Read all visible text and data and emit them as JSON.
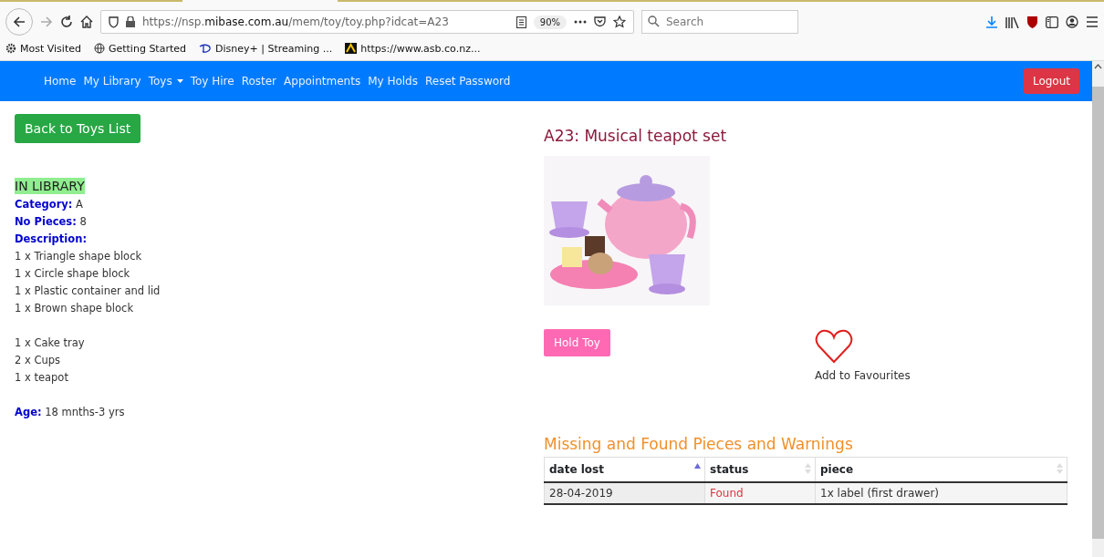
{
  "browser": {
    "url_host": "https://nsp.",
    "url_domain": "mibase.com.au",
    "url_path": "/mem/toy/toy.php?idcat=A23",
    "zoom": "90%",
    "search_placeholder": "Search",
    "bookmarks": [
      {
        "label": "Most Visited"
      },
      {
        "label": "Getting Started"
      },
      {
        "label": "Disney+ | Streaming ..."
      },
      {
        "label": "https://www.asb.co.nz..."
      }
    ]
  },
  "nav": {
    "items": [
      {
        "label": "Home",
        "dropdown": false
      },
      {
        "label": "My Library",
        "dropdown": false
      },
      {
        "label": "Toys",
        "dropdown": true
      },
      {
        "label": "Toy Hire",
        "dropdown": false
      },
      {
        "label": "Roster",
        "dropdown": false
      },
      {
        "label": "Appointments",
        "dropdown": false
      },
      {
        "label": "My Holds",
        "dropdown": false
      },
      {
        "label": "Reset Password",
        "dropdown": false
      }
    ],
    "logout": "Logout"
  },
  "back_button": "Back to Toys List",
  "status_badge": "IN LIBRARY",
  "details": [
    {
      "label": "Category:",
      "value": "A"
    },
    {
      "label": "No Pieces:",
      "value": "8"
    },
    {
      "label": "Description:"
    }
  ],
  "description_groups": [
    [
      "1 x Triangle shape block",
      "1 x Circle shape block",
      "1 x Plastic container and lid",
      "1 x Brown shape block"
    ],
    [
      "1 x Cake tray",
      "2 x Cups",
      "1 x teapot"
    ]
  ],
  "age": {
    "label": "Age:",
    "value": "18 mnths-3 yrs"
  },
  "toy_title": "A23: Musical teapot set",
  "toy_image": {
    "kind": "picture"
  },
  "hold_button": "Hold Toy",
  "favourites": "Add to Favourites",
  "missing_title": "Missing and Found Pieces and Warnings",
  "table": {
    "columns": [
      {
        "label": "date lost",
        "sorted": true
      },
      {
        "label": "status",
        "sorted": false
      },
      {
        "label": "piece",
        "sorted": false
      }
    ],
    "rows": [
      [
        "28-04-2019",
        "Found",
        "1x label (first drawer)"
      ]
    ]
  }
}
